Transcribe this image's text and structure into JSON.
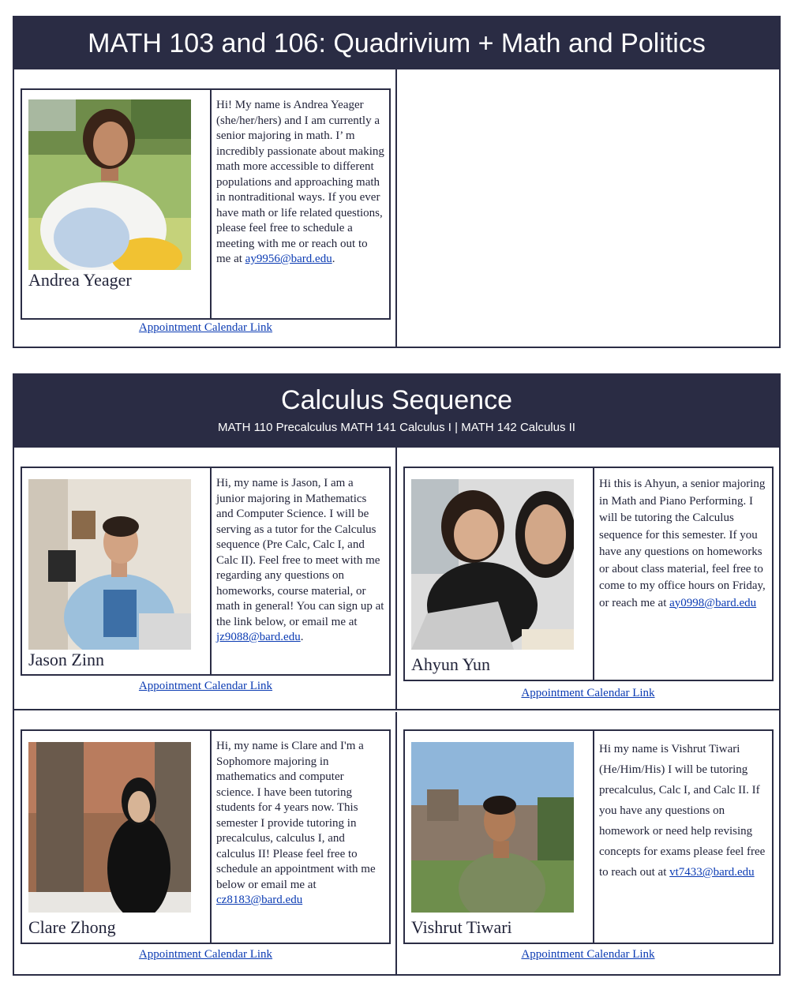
{
  "sections": [
    {
      "title": "MATH 103 and 106: Quadrivium + Math and Politics"
    },
    {
      "title": "Calculus Sequence",
      "subtitle": "MATH 110 Precalculus MATH 141 Calculus I | MATH 142 Calculus II"
    }
  ],
  "calendar_label": "Appointment Calendar Link",
  "tutors": [
    {
      "name": "Andrea Yeager",
      "bio": "Hi! My name is Andrea Yeager (she/her/hers) and I am currently a senior majoring in math. I’ m incredibly passionate about making math more accessible to different populations and approaching math in nontraditional ways. If you ever have math or life related questions, please feel free to schedule a meeting with me or reach out to me at ",
      "email": "ay9956@bard.edu",
      "tail": "."
    },
    {
      "name": "Jason Zinn",
      "bio": "Hi, my name is Jason, I am a junior majoring in Mathematics and Computer Science. I will be serving as a tutor for the Calculus sequence (Pre Calc, Calc I, and Calc II). Feel free to meet with me regarding any questions on homeworks, course material, or math in general! You can sign up at the link below, or email me at ",
      "email": "jz9088@bard.edu",
      "tail": "."
    },
    {
      "name": "Ahyun Yun",
      "bio": "Hi this is Ahyun, a senior majoring in Math and Piano Performing. I will be tutoring the Calculus sequence for this semester. If you have any questions on homeworks or about class material, feel free to come to my office hours on Friday, or reach me at ",
      "email": "ay0998@bard.edu",
      "tail": ""
    },
    {
      "name": "Clare Zhong",
      "bio": "Hi, my name is Clare and I'm a Sophomore majoring in mathematics and computer science. I have been tutoring students for 4 years now. This semester I provide tutoring in precalculus, calculus I, and calculus II! Please feel free to schedule an appointment with me below or email me at ",
      "email": "cz8183@bard.edu",
      "tail": ""
    },
    {
      "name": "Vishrut Tiwari",
      "bio": "Hi my name is Vishrut Tiwari (He/Him/His) I will be tutoring precalculus, Calc I, and Calc II. If you have any questions on homework or need help revising concepts for exams please feel free to reach out at ",
      "email": "vt7433@bard.edu",
      "tail": ""
    }
  ]
}
